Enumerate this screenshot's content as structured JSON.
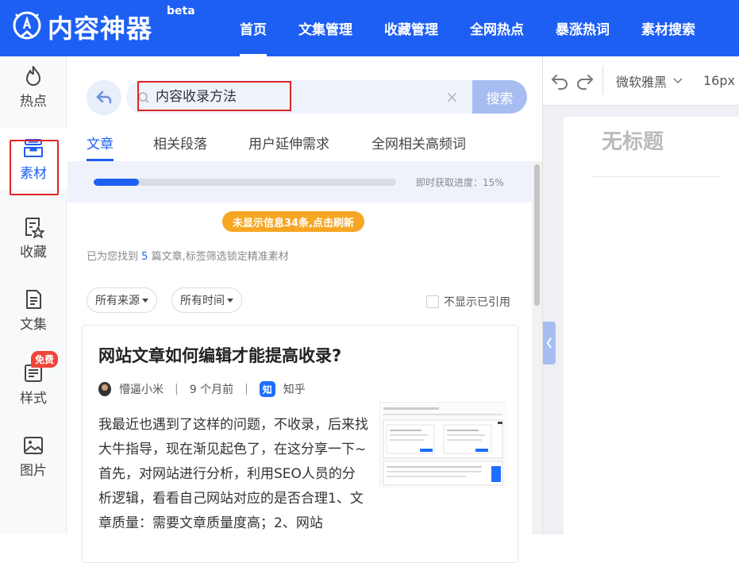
{
  "header": {
    "logo_text": "内容神器",
    "beta": "beta",
    "nav": [
      {
        "label": "首页",
        "active": true
      },
      {
        "label": "文集管理"
      },
      {
        "label": "收藏管理"
      },
      {
        "label": "全网热点"
      },
      {
        "label": "暴涨热词"
      },
      {
        "label": "素材搜索"
      }
    ]
  },
  "sidebar": {
    "items": [
      {
        "label": "热点",
        "icon": "flame-icon"
      },
      {
        "label": "素材",
        "icon": "material-box-icon",
        "active": true
      },
      {
        "label": "收藏",
        "icon": "favorite-star-icon"
      },
      {
        "label": "文集",
        "icon": "document-icon"
      },
      {
        "label": "样式",
        "icon": "style-icon",
        "badge": "免费"
      },
      {
        "label": "图片",
        "icon": "image-icon"
      }
    ]
  },
  "search": {
    "value": "内容收录方法",
    "button_label": "搜索",
    "clear": "×"
  },
  "tabs": [
    {
      "label": "文章",
      "active": true
    },
    {
      "label": "相关段落"
    },
    {
      "label": "用户延伸需求"
    },
    {
      "label": "全网相关高频词"
    }
  ],
  "progress": {
    "value": 0.15,
    "label": "即时获取进度：15%"
  },
  "refresh_notice": "未显示信息34条,点击刷新",
  "found": {
    "prefix": "已为您找到",
    "count": "5",
    "suffix": "篇文章,标签筛选锁定精准素材"
  },
  "filters": {
    "source": "所有来源",
    "time": "所有时间",
    "hide_cited": "不显示已引用"
  },
  "article": {
    "title": "网站文章如何编辑才能提高收录?",
    "author": "懵逼小米",
    "time": "9 个月前",
    "source_icon": "知",
    "source": "知乎",
    "separator": "|",
    "excerpt": "我最近也遇到了这样的问题，不收录，后来找大牛指导，现在渐见起色了，在这分享一下~首先，对网站进行分析，利用SEO人员的分析逻辑，看看自己网站对应的是否合理1、文章质量：需要文章质量度高；2、网站"
  },
  "editor": {
    "font": "微软雅黑",
    "font_size": "16px",
    "doc_title": "无标题"
  },
  "colors": {
    "brand": "#1e5ff3",
    "highlight_box": "#e02424",
    "notice": "#f6a623",
    "badge": "#f0443a"
  }
}
